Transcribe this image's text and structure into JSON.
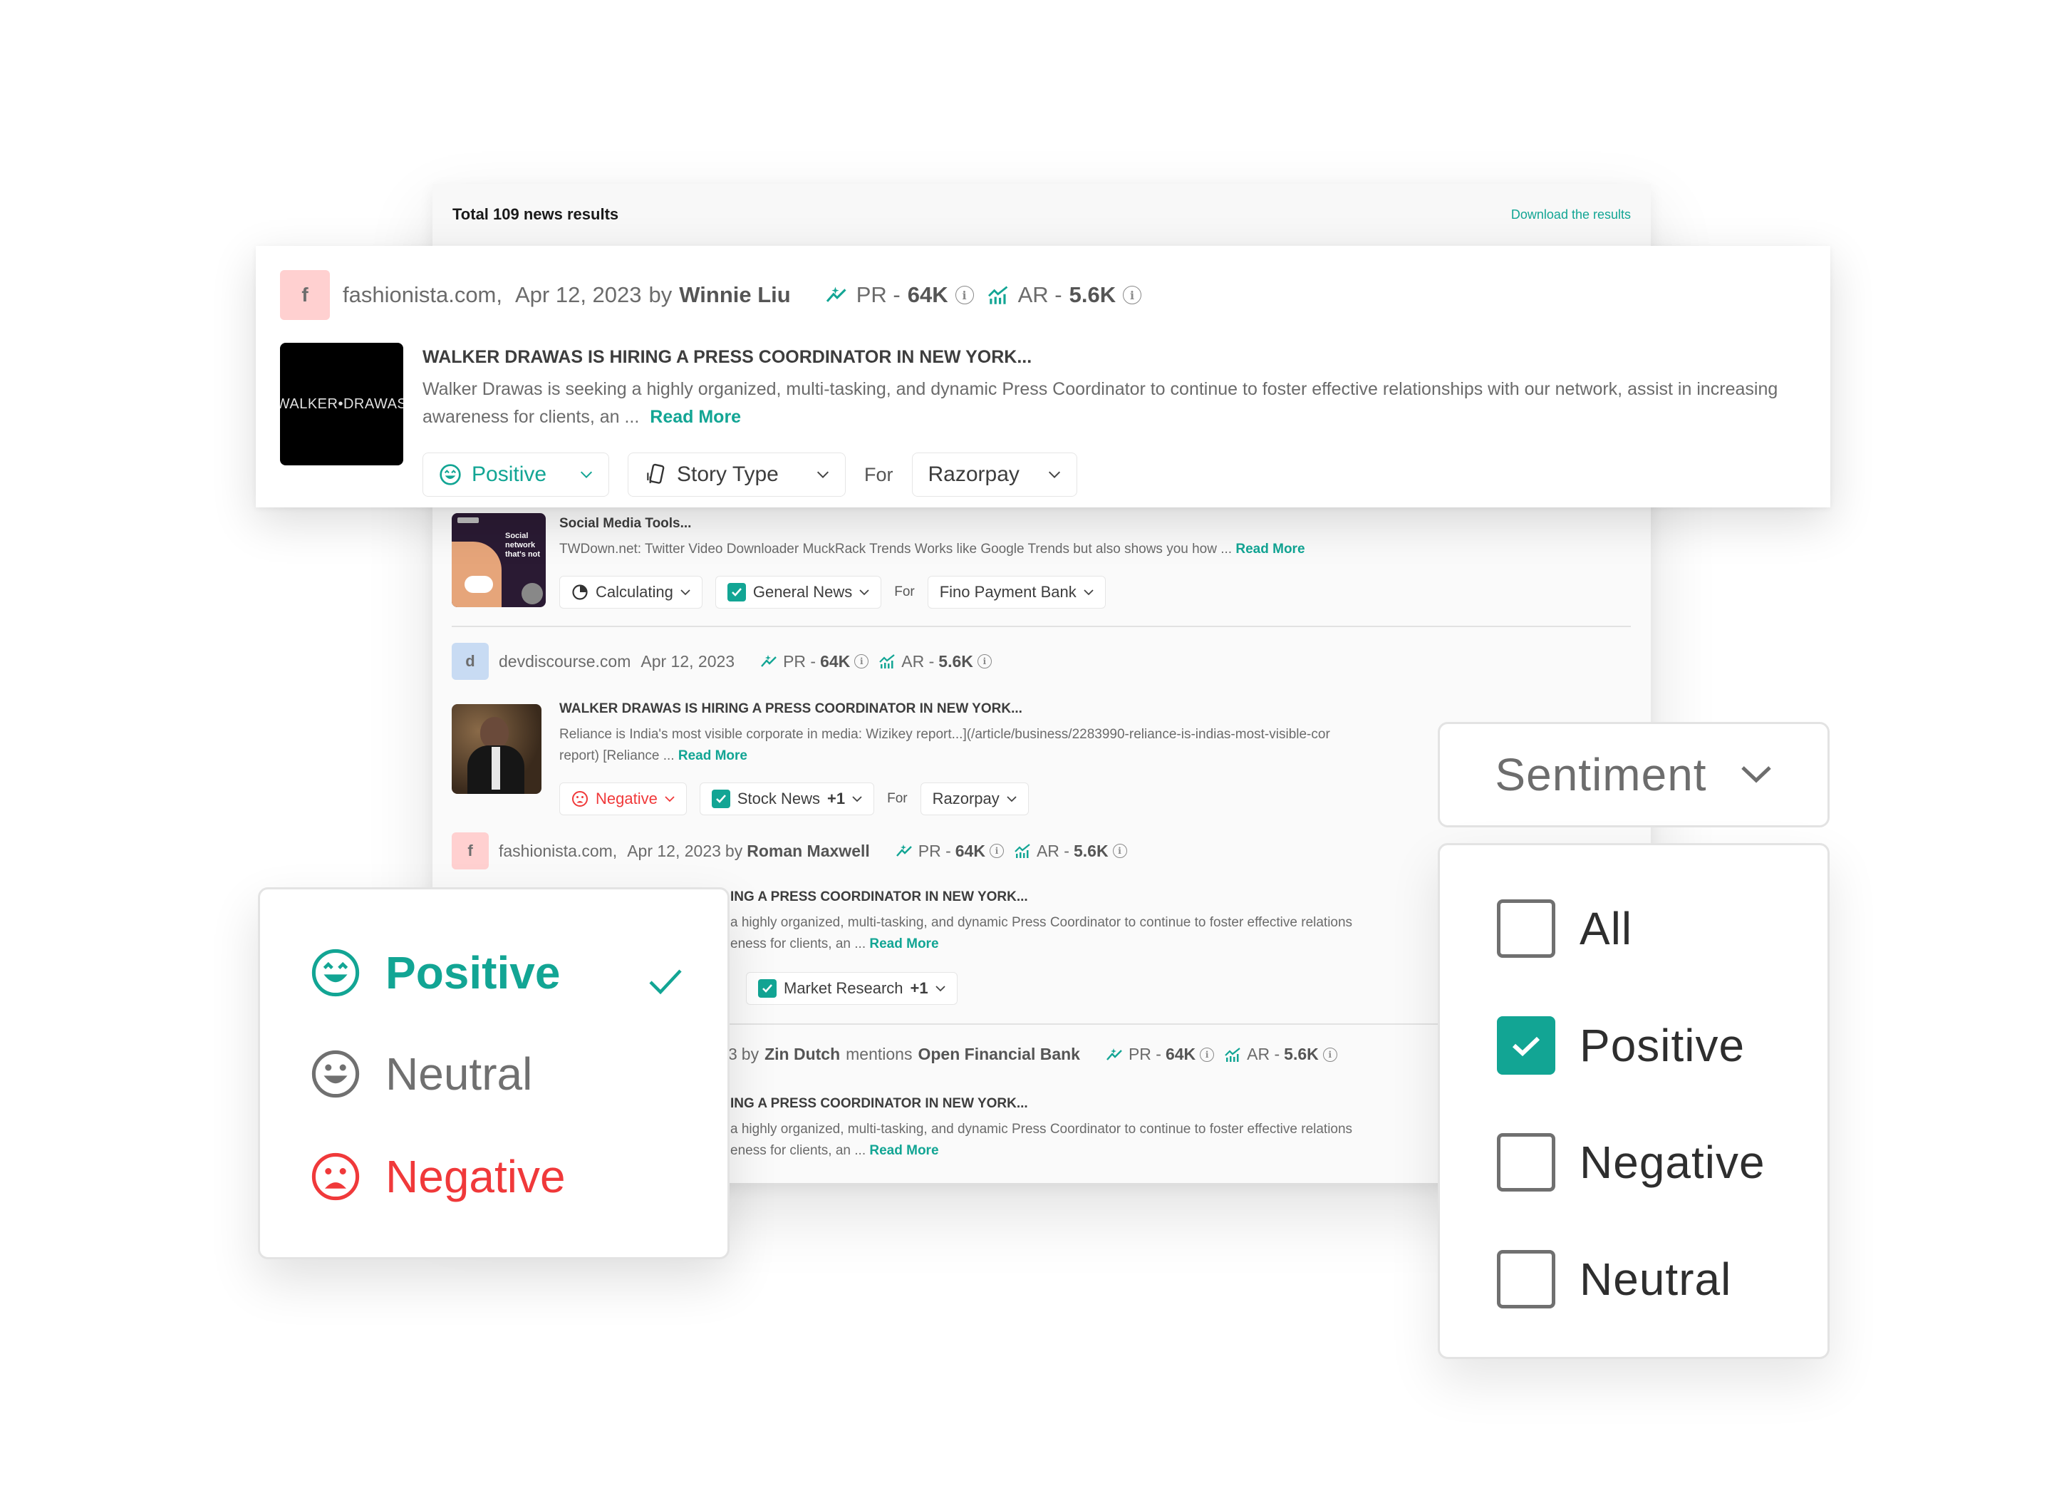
{
  "results": {
    "total_label": "Total 109 news results",
    "download_label": "Download the results"
  },
  "colors": {
    "accent": "#12a594",
    "positive": "#12a594",
    "neutral": "#707070",
    "negative": "#f0393a"
  },
  "highlighted_card": {
    "favicon_letter": "f",
    "source": "fashionista.com,",
    "date": "Apr 12, 2023",
    "by": "by",
    "author": "Winnie Liu",
    "pr_label": "PR -",
    "pr_value": "64K",
    "ar_label": "AR -",
    "ar_value": "5.6K",
    "thumbnail_text": "WALKER•DRAWAS",
    "headline": "WALKER DRAWAS IS HIRING A PRESS COORDINATOR IN NEW YORK...",
    "snippet": "Walker Drawas is seeking a highly organized, multi-tasking, and  dynamic Press Coordinator to continue to foster effective relationships with our network, assist in increasing awareness for clients, an ...",
    "read_more": "Read More",
    "sentiment": "Positive",
    "story_type": "Story Type",
    "for_label": "For",
    "company": "Razorpay"
  },
  "cards": [
    {
      "headline": "Social Media Tools...",
      "snippet": "TWDown.net: Twitter Video Downloader MuckRack Trends Works like Google Trends but also shows you how ...",
      "read_more": "Read More",
      "thumbnail_text": "Social network that's not",
      "sentiment": "Calculating",
      "story_type": "General News",
      "story_extra": "",
      "for_label": "For",
      "company": "Fino Payment Bank"
    },
    {
      "favicon_letter": "d",
      "source": "devdiscourse.com",
      "date": "Apr 12, 2023",
      "pr_label": "PR -",
      "pr_value": "64K",
      "ar_label": "AR -",
      "ar_value": "5.6K",
      "headline": "WALKER DRAWAS IS HIRING A PRESS COORDINATOR IN NEW YORK...",
      "snippet_line1": "Reliance is India's most visible corporate in media: Wizikey report...](/article/business/2283990-reliance-is-indias-most-visible-cor",
      "snippet_line2": "report) [Reliance ...",
      "read_more": "Read More",
      "sentiment": "Negative",
      "story_type": "Stock News",
      "story_extra": "+1",
      "for_label": "For",
      "company": "Razorpay"
    },
    {
      "favicon_letter": "f",
      "source": "fashionista.com,",
      "date": "Apr 12, 2023",
      "by": "by",
      "author": "Roman Maxwell",
      "pr_label": "PR -",
      "pr_value": "64K",
      "ar_label": "AR -",
      "ar_value": "5.6K",
      "headline": "ING A PRESS COORDINATOR IN NEW YORK...",
      "snippet_line1": " a highly organized, multi-tasking, and  dynamic Press Coordinator to continue to foster effective relations",
      "snippet_line2": "eness for clients, an ...",
      "read_more": "Read More",
      "story_type": "Market Research",
      "story_extra": "+1"
    },
    {
      "date_partial": "3",
      "by": "by",
      "author": "Zin Dutch",
      "mentions": "mentions",
      "company_mentioned": "Open Financial Bank",
      "pr_label": "PR -",
      "pr_value": "64K",
      "ar_label": "AR -",
      "ar_value": "5.6K",
      "headline": "ING A PRESS COORDINATOR IN NEW YORK...",
      "snippet_line1": " a highly organized, multi-tasking, and  dynamic Press Coordinator to continue to foster effective relations",
      "snippet_line2": "eness for clients, an ...",
      "read_more": "Read More"
    }
  ],
  "sentiment_popover": {
    "options": [
      {
        "label": "Positive",
        "icon": "smile-happy-icon",
        "selected": true
      },
      {
        "label": "Neutral",
        "icon": "smile-neutral-icon",
        "selected": false
      },
      {
        "label": "Negative",
        "icon": "frown-icon",
        "selected": false
      }
    ]
  },
  "sentiment_filter": {
    "button_label": "Sentiment",
    "options": [
      {
        "label": "All",
        "checked": false
      },
      {
        "label": "Positive",
        "checked": true
      },
      {
        "label": "Negative",
        "checked": false
      },
      {
        "label": "Neutral",
        "checked": false
      }
    ]
  }
}
